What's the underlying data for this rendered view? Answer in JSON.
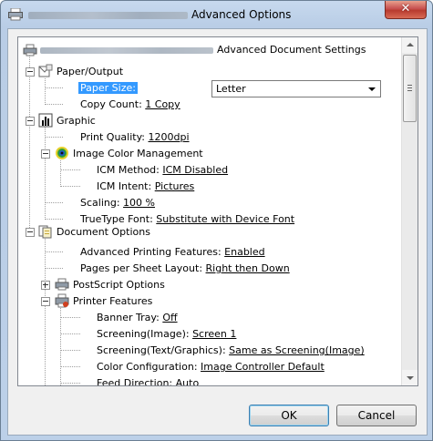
{
  "window": {
    "title": "Advanced Options",
    "close_glyph": "✕"
  },
  "tree": {
    "root": {
      "label": "Advanced Document Settings",
      "icon": "printer-icon"
    },
    "paper_output": {
      "label": "Paper/Output",
      "icon": "paper-icon"
    },
    "paper_size": {
      "label": "Paper Size:",
      "value": "Letter"
    },
    "copy_count": {
      "label": "Copy Count:",
      "value": "1 Copy"
    },
    "graphic": {
      "label": "Graphic",
      "icon": "chart-icon"
    },
    "print_quality": {
      "label": "Print Quality:",
      "value": "1200dpi"
    },
    "icm": {
      "label": "Image Color Management",
      "icon": "color-wheel-icon"
    },
    "icm_method": {
      "label": "ICM Method:",
      "value": "ICM Disabled"
    },
    "icm_intent": {
      "label": "ICM Intent:",
      "value": "Pictures"
    },
    "scaling": {
      "label": "Scaling:",
      "value": "100 %"
    },
    "truetype": {
      "label": "TrueType Font:",
      "value": "Substitute with Device Font"
    },
    "doc_options": {
      "label": "Document Options",
      "icon": "documents-icon"
    },
    "adv_printing": {
      "label": "Advanced Printing Features:",
      "value": "Enabled"
    },
    "pages_layout": {
      "label": "Pages per Sheet Layout:",
      "value": "Right then Down"
    },
    "postscript": {
      "label": "PostScript Options",
      "icon": "printer-icon"
    },
    "printer_features": {
      "label": "Printer Features",
      "icon": "printer-features-icon"
    },
    "banner_tray": {
      "label": "Banner Tray:",
      "value": "Off"
    },
    "screening_image": {
      "label": "Screening(Image):",
      "value": "Screen 1"
    },
    "screening_text": {
      "label": "Screening(Text/Graphics):",
      "value": "Same as Screening(Image)"
    },
    "color_config": {
      "label": "Color Configuration:",
      "value": "Image Controller Default"
    },
    "feed_direction": {
      "label": "Feed Direction:",
      "value": "Auto"
    }
  },
  "buttons": {
    "ok": "OK",
    "cancel": "Cancel"
  },
  "colors": {
    "selection": "#3399ff",
    "close": "#c75050"
  }
}
